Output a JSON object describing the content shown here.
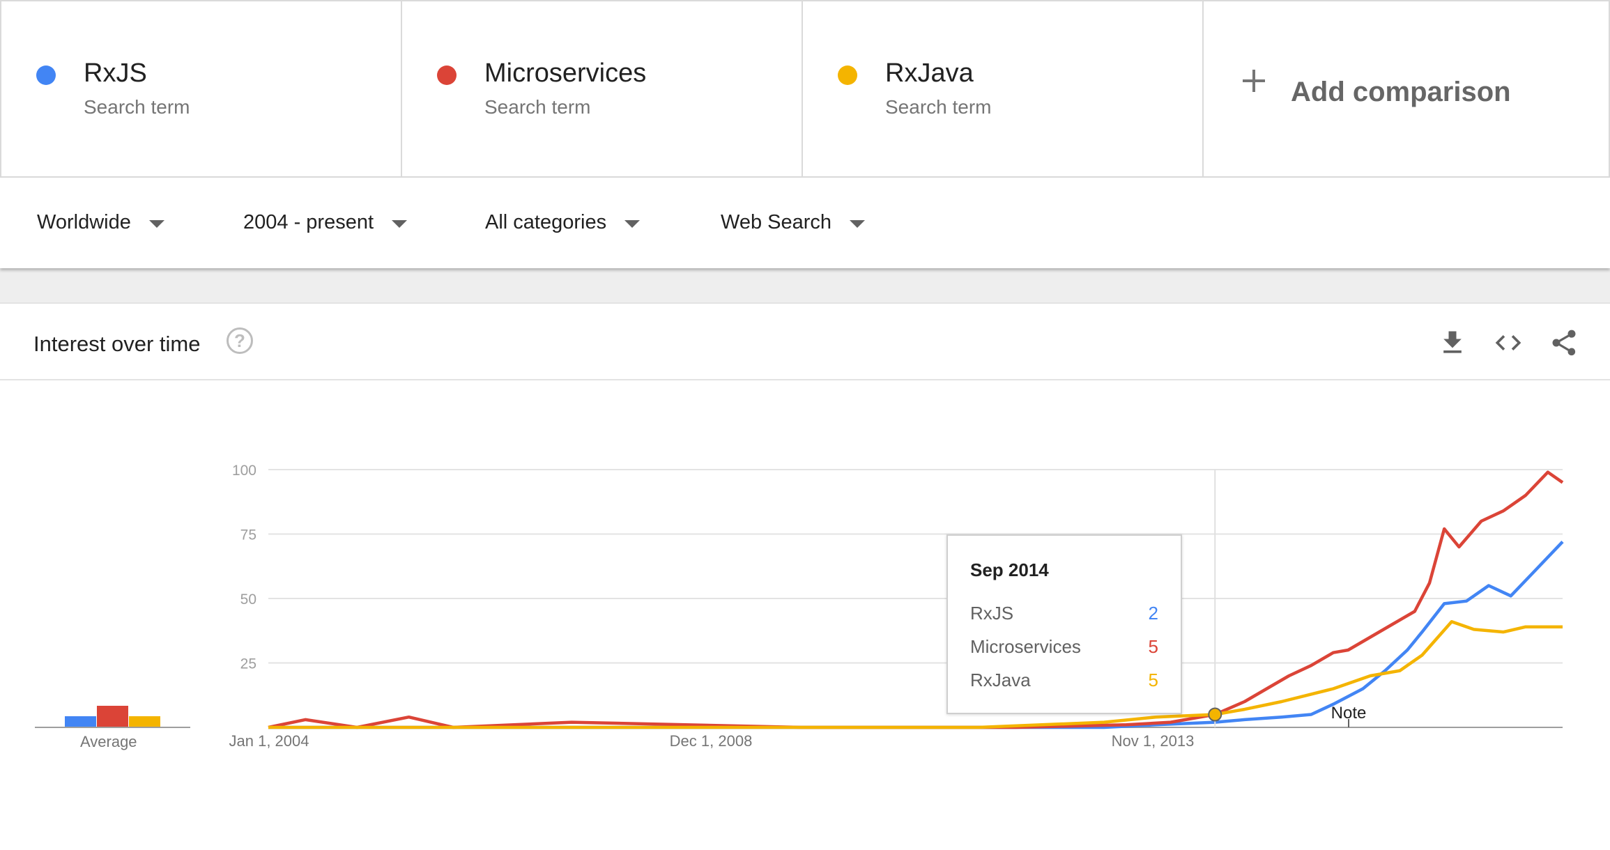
{
  "colors": {
    "rxjs": "#4285f4",
    "microservices": "#db4437",
    "rxjava": "#f4b400"
  },
  "terms": [
    {
      "name": "RxJS",
      "sub": "Search term",
      "color": "#4285f4"
    },
    {
      "name": "Microservices",
      "sub": "Search term",
      "color": "#db4437"
    },
    {
      "name": "RxJava",
      "sub": "Search term",
      "color": "#f4b400"
    }
  ],
  "add_comparison": "Add comparison",
  "filters": [
    "Worldwide",
    "2004 - present",
    "All categories",
    "Web Search"
  ],
  "card": {
    "title": "Interest over time",
    "help": "?"
  },
  "average_label": "Average",
  "tooltip": {
    "title": "Sep 2014",
    "rows": [
      {
        "name": "RxJS",
        "value": "2",
        "color": "#4285f4"
      },
      {
        "name": "Microservices",
        "value": "5",
        "color": "#db4437"
      },
      {
        "name": "RxJava",
        "value": "5",
        "color": "#f4b400"
      }
    ]
  },
  "note_label": "Note",
  "chart_data": {
    "type": "line",
    "ylim": [
      0,
      100
    ],
    "y_ticks": [
      25,
      50,
      75,
      100
    ],
    "x_tick_labels": [
      "Jan 1, 2004",
      "Dec 1, 2008",
      "Nov 1, 2013"
    ],
    "x_range": [
      "2004-01",
      "2018-08"
    ],
    "highlight_x": "2014-09",
    "average": {
      "RxJS": 6,
      "Microservices": 12,
      "RxJava": 6
    },
    "series": [
      {
        "name": "RxJS",
        "color": "#4285f4",
        "x": [
          "2004-01",
          "2012-01",
          "2013-06",
          "2014-01",
          "2014-09",
          "2015-01",
          "2015-06",
          "2015-10",
          "2016-01",
          "2016-05",
          "2016-08",
          "2016-11",
          "2017-01",
          "2017-04",
          "2017-07",
          "2017-10",
          "2018-01",
          "2018-04",
          "2018-08"
        ],
        "y": [
          0,
          0,
          0,
          1,
          2,
          3,
          4,
          5,
          9,
          15,
          22,
          30,
          37,
          48,
          49,
          55,
          51,
          60,
          72
        ]
      },
      {
        "name": "Microservices",
        "color": "#db4437",
        "x": [
          "2004-01",
          "2004-06",
          "2005-01",
          "2005-08",
          "2006-02",
          "2007-06",
          "2010-01",
          "2012-06",
          "2013-09",
          "2014-03",
          "2014-09",
          "2015-01",
          "2015-04",
          "2015-07",
          "2015-10",
          "2016-01",
          "2016-03",
          "2016-06",
          "2016-09",
          "2016-12",
          "2017-02",
          "2017-04",
          "2017-06",
          "2017-09",
          "2017-12",
          "2018-03",
          "2018-06",
          "2018-08"
        ],
        "y": [
          0,
          3,
          0,
          4,
          0,
          2,
          0,
          0,
          1,
          2,
          5,
          10,
          15,
          20,
          24,
          29,
          30,
          35,
          40,
          45,
          56,
          77,
          70,
          80,
          84,
          90,
          99,
          95
        ]
      },
      {
        "name": "RxJava",
        "color": "#f4b400",
        "x": [
          "2004-01",
          "2012-01",
          "2013-06",
          "2014-01",
          "2014-09",
          "2015-01",
          "2015-06",
          "2016-01",
          "2016-06",
          "2016-10",
          "2017-01",
          "2017-05",
          "2017-08",
          "2017-12",
          "2018-03",
          "2018-08"
        ],
        "y": [
          0,
          0,
          2,
          4,
          5,
          7,
          10,
          15,
          20,
          22,
          28,
          41,
          38,
          37,
          39,
          39
        ]
      }
    ]
  }
}
